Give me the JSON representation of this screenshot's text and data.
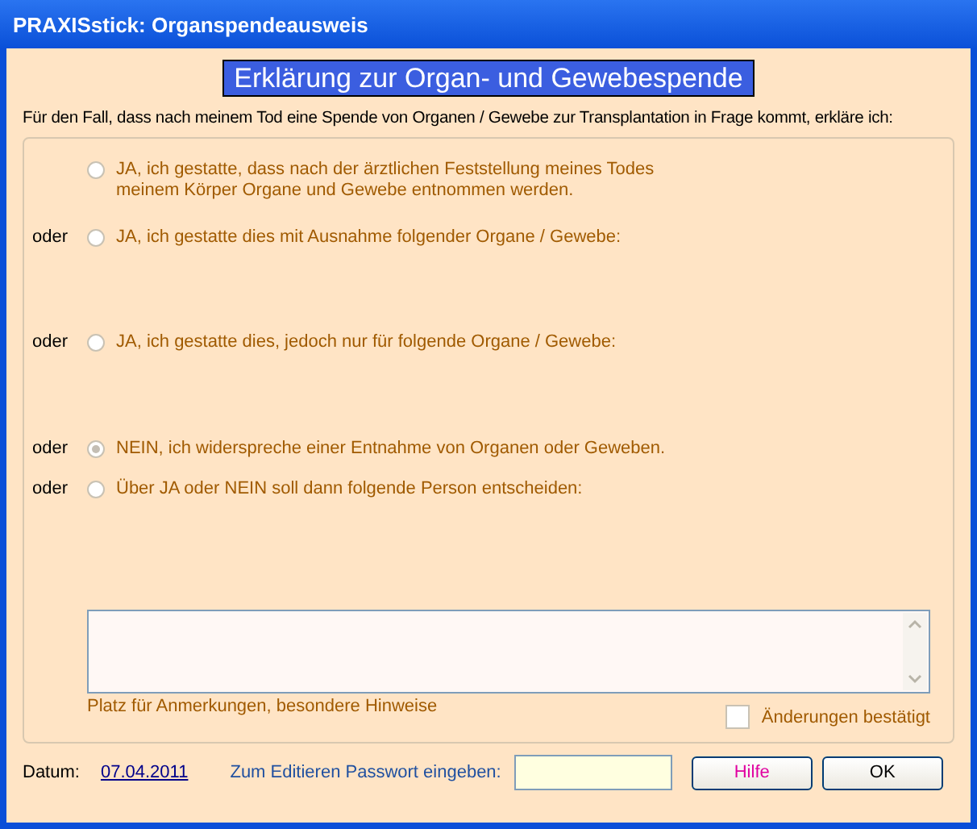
{
  "window": {
    "title": "PRAXISstick: Organspendeausweis"
  },
  "heading": "Erklärung zur Organ- und Gewebespende",
  "intro": "Für den Fall, dass nach meinem Tod eine Spende von Organen / Gewebe zur Transplantation in Frage kommt, erkläre ich:",
  "options": [
    {
      "label": "JA, ich gestatte, dass nach der ärztlichen Feststellung meines Todes\nmeinem Körper Organe und Gewebe entnommen werden.",
      "selected": false
    },
    {
      "prefix": "oder",
      "label": "JA, ich gestatte dies mit Ausnahme folgender Organe / Gewebe:",
      "selected": false
    },
    {
      "prefix": "oder",
      "label": "JA, ich gestatte dies, jedoch nur für folgende Organe / Gewebe:",
      "selected": false
    },
    {
      "prefix": "oder",
      "label": "NEIN, ich widerspreche einer Entnahme von Organen oder Geweben.",
      "selected": true
    },
    {
      "prefix": "oder",
      "label": "Über JA oder NEIN soll dann folgende Person entscheiden:",
      "selected": false
    }
  ],
  "notes": {
    "caption": "Platz für Anmerkungen, besondere Hinweise"
  },
  "confirm": {
    "label": "Änderungen bestätigt",
    "checked": false
  },
  "footer": {
    "date_label": "Datum:",
    "date": "07.04.2011",
    "password_label": "Zum Editieren Passwort eingeben:"
  },
  "buttons": [
    {
      "label": "Hilfe",
      "kind": "help"
    },
    {
      "label": "OK",
      "kind": "ok"
    }
  ]
}
